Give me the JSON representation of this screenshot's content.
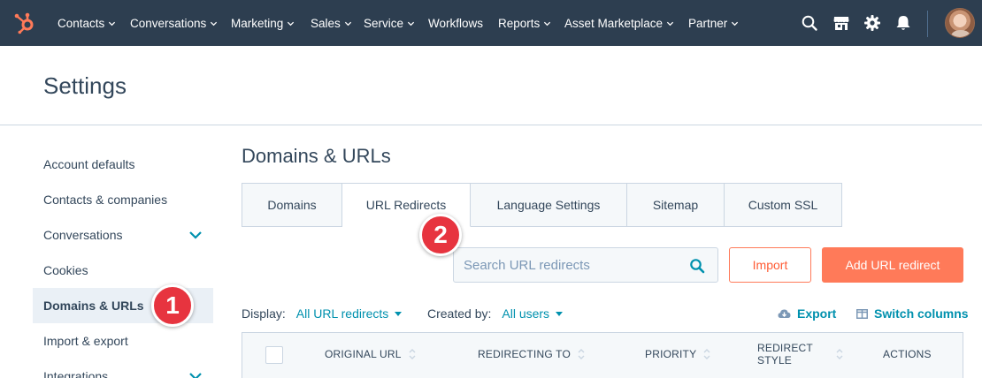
{
  "topnav": {
    "items": [
      {
        "label": "Contacts"
      },
      {
        "label": "Conversations"
      },
      {
        "label": "Marketing"
      },
      {
        "label": "Sales"
      },
      {
        "label": "Service"
      },
      {
        "label": "Workflows"
      },
      {
        "label": "Reports"
      },
      {
        "label": "Asset Marketplace"
      },
      {
        "label": "Partner"
      }
    ],
    "icons": [
      "search-icon",
      "marketplace-icon",
      "gear-icon",
      "bell-icon"
    ]
  },
  "settings": {
    "title": "Settings"
  },
  "sidebar": {
    "items": [
      {
        "label": "Account defaults"
      },
      {
        "label": "Contacts & companies"
      },
      {
        "label": "Conversations"
      },
      {
        "label": "Cookies"
      },
      {
        "label": "Domains & URLs"
      },
      {
        "label": "Import & export"
      },
      {
        "label": "Integrations"
      }
    ],
    "active": "Domains & URLs"
  },
  "annotations": {
    "badge1": "1",
    "badge2": "2"
  },
  "main": {
    "title": "Domains & URLs",
    "tabs": [
      {
        "label": "Domains"
      },
      {
        "label": "URL Redirects"
      },
      {
        "label": "Language Settings"
      },
      {
        "label": "Sitemap"
      },
      {
        "label": "Custom SSL"
      }
    ],
    "active_tab": "URL Redirects",
    "search": {
      "placeholder": "Search URL redirects"
    },
    "import_label": "Import",
    "add_label": "Add URL redirect",
    "filters": {
      "display_label": "Display:",
      "display_value": "All URL redirects",
      "created_label": "Created by:",
      "created_value": "All users"
    },
    "export_label": "Export",
    "switch_columns_label": "Switch columns",
    "table": {
      "columns": [
        {
          "label": "ORIGINAL URL"
        },
        {
          "label": "REDIRECTING TO"
        },
        {
          "label": "PRIORITY"
        },
        {
          "label": "REDIRECT",
          "label2": "STYLE"
        },
        {
          "label": "ACTIONS"
        }
      ]
    }
  },
  "colors": {
    "nav_bg": "#2d3e50",
    "accent_orange": "#ff7a59",
    "link_teal": "#0091ae",
    "badge_red": "#e7343f",
    "text": "#33475b"
  }
}
